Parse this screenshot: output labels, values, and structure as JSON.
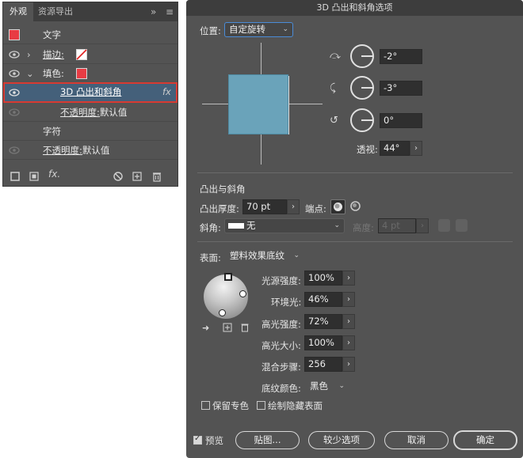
{
  "appearance_panel": {
    "tabs": [
      "外观",
      "资源导出"
    ],
    "collapse_icon": "»",
    "menu_icon": "≡",
    "rows": {
      "text_label": "文字",
      "stroke_label": "描边:",
      "fill_label": "填色:",
      "effect_label": "3D 凸出和斜角",
      "fx_label": "fx",
      "opacity_label": "不透明度:",
      "opacity_value": "默认值",
      "chars_label": "字符",
      "opacity2_label": "不透明度:",
      "opacity2_value": "默认值"
    },
    "bottom_icons": [
      "new-stroke-icon",
      "new-fill-icon",
      "add-effect-icon",
      "clear-icon",
      "duplicate-icon",
      "delete-icon"
    ],
    "fx_bottom": "fx."
  },
  "dialog": {
    "title": "3D 凸出和斜角选项",
    "position_label": "位置:",
    "position_value": "自定旋转",
    "rotation": {
      "x": "-2°",
      "y": "-3°",
      "z": "0°",
      "perspective_label": "透视:",
      "perspective_value": "44°"
    },
    "extrude_section": "凸出与斜角",
    "extrude_depth_label": "凸出厚度:",
    "extrude_depth_value": "70 pt",
    "cap_label": "端点:",
    "bevel_label": "斜角:",
    "bevel_value": "无",
    "height_label": "高度:",
    "height_value": "4 pt",
    "surface_label": "表面:",
    "surface_value": "塑料效果底纹",
    "light_intensity_label": "光源强度:",
    "light_intensity_value": "100%",
    "ambient_label": "环境光:",
    "ambient_value": "46%",
    "highlight_intensity_label": "高光强度:",
    "highlight_intensity_value": "72%",
    "highlight_size_label": "高光大小:",
    "highlight_size_value": "100%",
    "blend_steps_label": "混合步骤:",
    "blend_steps_value": "256",
    "shading_color_label": "底纹颜色:",
    "shading_color_value": "黑色",
    "preserve_spot_label": "保留专色",
    "draw_hidden_label": "绘制隐藏表面",
    "preview_label": "预览",
    "map_art_label": "贴图...",
    "fewer_options_label": "较少选项",
    "cancel_label": "取消",
    "ok_label": "确定"
  },
  "colors": {
    "panel_bg": "#535353",
    "cube_face": "#6aa3ba",
    "selection_outline": "#d83a32",
    "red_swatch": "#e83c44"
  }
}
